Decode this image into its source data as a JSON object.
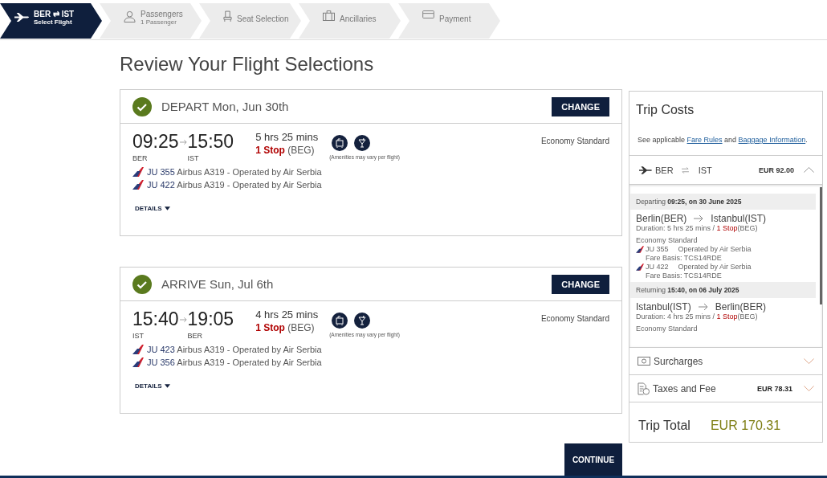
{
  "steps": [
    {
      "kind": "route",
      "label": "BER ⇄ IST",
      "sub": "Select Flight",
      "selected": true
    },
    {
      "kind": "person",
      "label": "Passengers",
      "sub": "1 Passenger",
      "selected": false
    },
    {
      "kind": "seat",
      "label": "Seat Selection",
      "selected": false
    },
    {
      "kind": "luggage",
      "label": "Ancillaries",
      "selected": false
    },
    {
      "kind": "card",
      "label": "Payment",
      "selected": false
    }
  ],
  "page_title": "Review Your Flight Selections",
  "flights": [
    {
      "direction": "DEPART",
      "date": "Mon, Jun 30th",
      "change": "CHANGE",
      "confirmed": true,
      "depart_time": "09:25",
      "arrive_time": "15:50",
      "from": "BER",
      "to": "IST",
      "duration": "5 hrs 25 mins",
      "stops": "1 Stop",
      "via": "(BEG)",
      "amenities_note": "(Amenities may vary per flight)",
      "cabin": "Economy Standard",
      "details": "DETAILS",
      "segments": [
        {
          "flight": "JU 355",
          "text": "Airbus A319 - Operated by Air Serbia"
        },
        {
          "flight": "JU 422",
          "text": "Airbus A319 - Operated by Air Serbia"
        }
      ]
    },
    {
      "direction": "ARRIVE",
      "date": "Sun, Jul 6th",
      "change": "CHANGE",
      "confirmed": true,
      "depart_time": "15:40",
      "arrive_time": "19:05",
      "from": "IST",
      "to": "BER",
      "duration": "4 hrs 25 mins",
      "stops": "1 Stop",
      "via": "(BEG)",
      "amenities_note": "(Amenities may vary per flight)",
      "cabin": "Economy Standard",
      "details": "DETAILS",
      "segments": [
        {
          "flight": "JU 423",
          "text": "Airbus A319 - Operated by Air Serbia"
        },
        {
          "flight": "JU 356",
          "text": "Airbus A319 - Operated by Air Serbia"
        }
      ]
    }
  ],
  "continue": "CONTINUE",
  "costs": {
    "title": "Trip Costs",
    "note_before": "See applicable",
    "link_1": "Fare Rules",
    "note_middle": "and",
    "link_2": "Baggage Information",
    "note_after": ".",
    "route": {
      "from": "BER",
      "to": "IST",
      "price": "EUR 92.00",
      "expanded": true
    },
    "legs": [
      {
        "label": "Departing",
        "when": "09:25, on 30 June 2025",
        "from": "Berlin(BER)",
        "to": "Istanbul(IST)",
        "duration": "Duration: 5 hrs 25 mins /",
        "stops": "1 Stop",
        "via": "(BEG)",
        "cabin": "Economy Standard",
        "segments": [
          {
            "flight": "JU 355",
            "operator": "Operated by Air Serbia",
            "fare_basis": "Fare Basis: TCS14RDE"
          },
          {
            "flight": "JU 422",
            "operator": "Operated by Air Serbia",
            "fare_basis": "Fare Basis: TCS14RDE"
          }
        ]
      },
      {
        "label": "Returning",
        "when": "15:40, on 06 July 2025",
        "from": "Istanbul(IST)",
        "to": "Berlin(BER)",
        "duration": "Duration: 4 hrs 25 mins /",
        "stops": "1 Stop",
        "via": "(BEG)",
        "cabin": "Economy Standard"
      }
    ],
    "surcharges": {
      "label": "Surcharges",
      "expanded": false
    },
    "taxes": {
      "label": "Taxes and Fee",
      "amount": "EUR 78.31",
      "expanded": false
    },
    "total_label": "Trip Total",
    "total": "EUR 170.31"
  }
}
